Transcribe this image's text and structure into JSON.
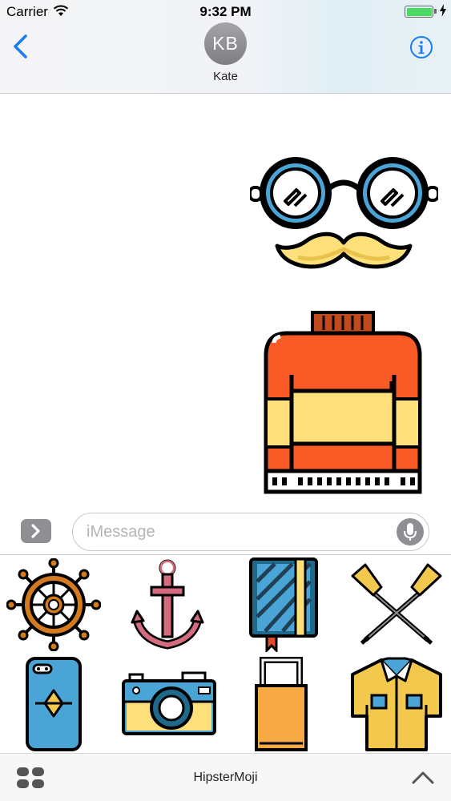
{
  "status_bar": {
    "carrier": "Carrier",
    "time": "9:32 PM",
    "battery_level": 1.0
  },
  "header": {
    "contact_initials": "KB",
    "contact_name": "Kate",
    "back_icon": "chevron-left-icon",
    "info_icon": "info-icon"
  },
  "messages": [
    {
      "type": "sticker",
      "name": "glasses-mustache"
    },
    {
      "type": "sticker",
      "name": "sweater"
    }
  ],
  "composer": {
    "placeholder": "iMessage",
    "apps_icon": "chevron-right-icon",
    "mic_icon": "microphone-icon"
  },
  "drawer": {
    "stickers": [
      "ship-wheel",
      "anchor",
      "notebook",
      "crossed-oars",
      "phone",
      "camera",
      "tote-bag",
      "shirt"
    ]
  },
  "bottom_bar": {
    "app_name": "HipsterMoji",
    "apps_icon": "app-grid-icon",
    "expand_icon": "chevron-up-icon"
  },
  "colors": {
    "accent": "#1a7cf3",
    "orange": "#f95a26",
    "yellow": "#fde07a",
    "blue": "#4aa5d6",
    "teal_dark": "#1f6a8b"
  }
}
